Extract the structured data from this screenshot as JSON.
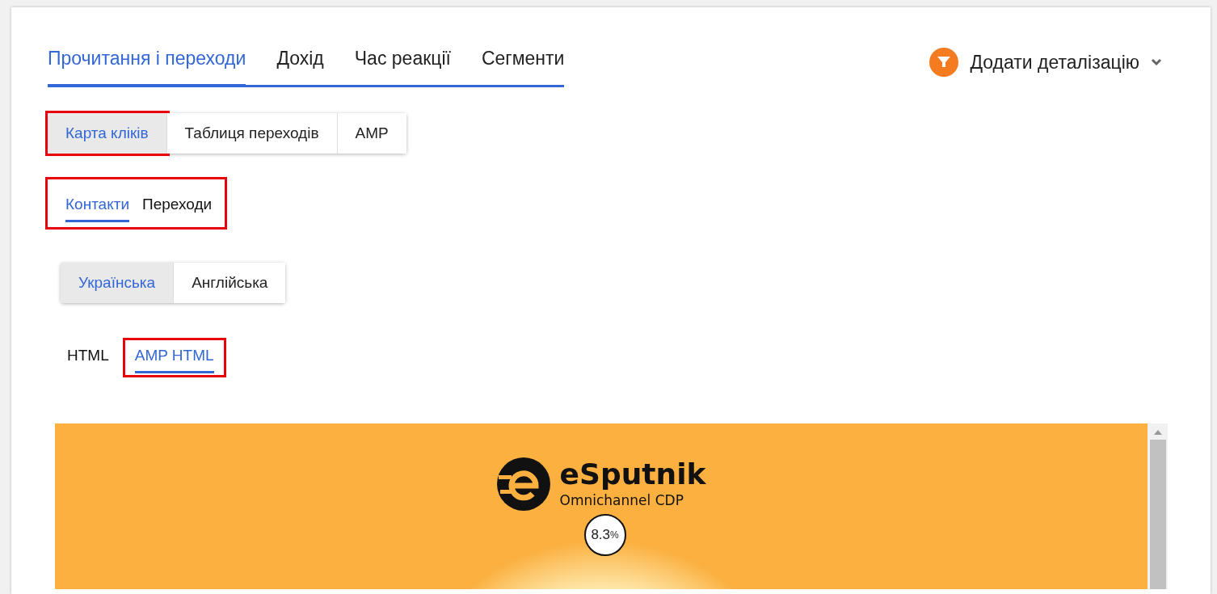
{
  "main_tabs": [
    {
      "label": "Прочитання і переходи",
      "selected": true
    },
    {
      "label": "Дохід",
      "selected": false
    },
    {
      "label": "Час реакції",
      "selected": false
    },
    {
      "label": "Сегменти",
      "selected": false
    }
  ],
  "detail_button": {
    "label": "Додати деталізацію"
  },
  "view_buttons": [
    {
      "label": "Карта кліків",
      "selected": true,
      "highlighted": true
    },
    {
      "label": "Таблиця переходів",
      "selected": false,
      "highlighted": false
    },
    {
      "label": "AMP",
      "selected": false,
      "highlighted": false
    }
  ],
  "metric_tabs": {
    "highlighted": true,
    "items": [
      {
        "label": "Контакти",
        "selected": true
      },
      {
        "label": "Переходи",
        "selected": false
      }
    ]
  },
  "language_buttons": [
    {
      "label": "Українська",
      "selected": true
    },
    {
      "label": "Англійська",
      "selected": false
    }
  ],
  "format_tabs": [
    {
      "label": "HTML",
      "selected": false,
      "highlighted": false
    },
    {
      "label": "AMP HTML",
      "selected": true,
      "highlighted": true
    }
  ],
  "preview": {
    "logo_name": "eSputnik",
    "logo_tagline": "Omnichannel CDP",
    "click_bubble": {
      "value": "8.3",
      "unit": "%"
    }
  }
}
